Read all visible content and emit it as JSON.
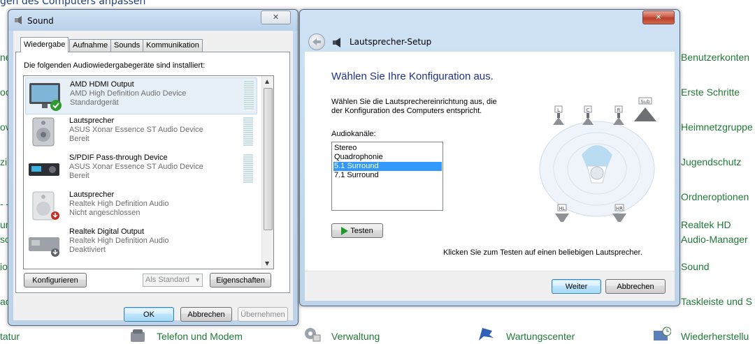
{
  "control_panel": {
    "title": "gen des Computers anpassen",
    "links_right": [
      "Benutzerkonten",
      "Erste Schritte",
      "Heimnetzgruppe",
      "Jugendschutz",
      "Ordneroptionen",
      "Realtek HD",
      "Audio-Manager",
      "Sound",
      "Taskleiste und S"
    ],
    "links_left_partial": [
      "ne",
      "oo",
      "ov",
      "zi",
      "- -",
      "ur",
      "so",
      "io",
      "ac"
    ],
    "bottom_links": [
      "tatur",
      "Telefon und Modem",
      "Verwaltung",
      "Wartungscenter",
      "Wiederherstellu"
    ]
  },
  "sound_dialog": {
    "title": "Sound",
    "close": "✕",
    "tabs": [
      "Wiedergabe",
      "Aufnahme",
      "Sounds",
      "Kommunikation"
    ],
    "intro": "Die folgenden Audiowiedergabegeräte sind installiert:",
    "devices": [
      {
        "name": "AMD HDMI Output",
        "driver": "AMD High Definition Audio Device",
        "status": "Standardgerät"
      },
      {
        "name": "Lautsprecher",
        "driver": "ASUS Xonar Essence ST Audio Device",
        "status": "Bereit"
      },
      {
        "name": "S/PDIF Pass-through Device",
        "driver": "ASUS Xonar Essence ST Audio Device",
        "status": "Bereit"
      },
      {
        "name": "Lautsprecher",
        "driver": "Realtek High Definition Audio",
        "status": "Nicht angeschlossen"
      },
      {
        "name": "Realtek Digital Output",
        "driver": "Realtek High Definition Audio",
        "status": "Deaktiviert"
      }
    ],
    "buttons": {
      "configure": "Konfigurieren",
      "default": "Als Standard",
      "properties": "Eigenschaften",
      "ok": "OK",
      "cancel": "Abbrechen",
      "apply": "Übernehmen"
    }
  },
  "speaker_setup": {
    "title": "Lautsprecher-Setup",
    "close": "✕",
    "heading": "Wählen Sie Ihre Konfiguration aus.",
    "desc_line1": "Wählen Sie die Lautsprechereinrichtung aus, die",
    "desc_line2": "der Konfiguration des Computers entspricht.",
    "channels_label": "Audiokanäle:",
    "channels": [
      "Stereo",
      "Quadrophonie",
      "5.1 Surround",
      "7.1 Surround"
    ],
    "selected_channel": "5.1 Surround",
    "test_button": "Testen",
    "hint": "Klicken Sie zum Testen auf einen beliebigen Lautsprecher.",
    "speaker_labels": [
      "L",
      "C",
      "R",
      "Sub",
      "HL",
      "HR"
    ],
    "next_button": "Weiter",
    "cancel_button": "Abbrechen"
  }
}
